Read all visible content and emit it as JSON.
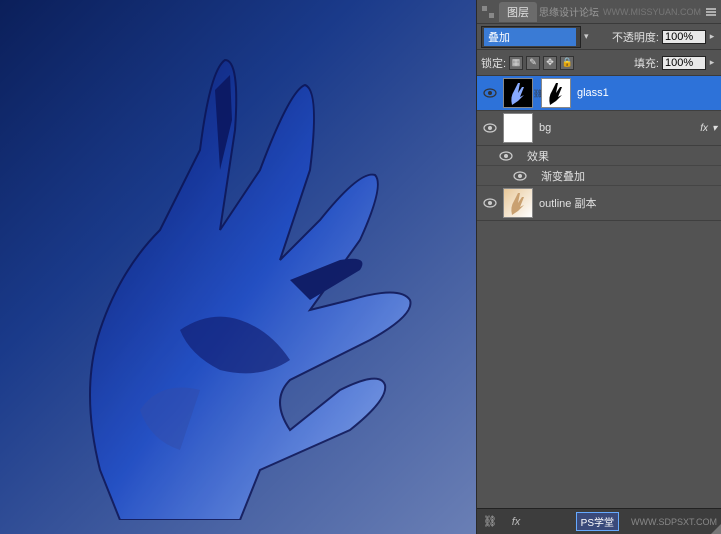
{
  "header": {
    "tab_label": "图层",
    "watermark_text": "思缘设计论坛",
    "watermark_url": "WWW.MISSYUAN.COM"
  },
  "blend_row": {
    "mode": "叠加",
    "opacity_label": "不透明度:",
    "opacity_value": "100%"
  },
  "lock_row": {
    "lock_label": "锁定:",
    "fill_label": "填充:",
    "fill_value": "100%"
  },
  "layers": [
    {
      "name": "glass1",
      "selected": true,
      "has_mask": true
    },
    {
      "name": "bg",
      "has_fx": true
    },
    {
      "name": "效果",
      "is_sublabel": true
    },
    {
      "name": "渐变叠加",
      "is_sublabel": true
    },
    {
      "name": "outline 副本"
    }
  ],
  "fx_label": "fx",
  "bottom": {
    "ps_badge": "PS学堂",
    "url": "WWW.SDPSXT.COM"
  }
}
